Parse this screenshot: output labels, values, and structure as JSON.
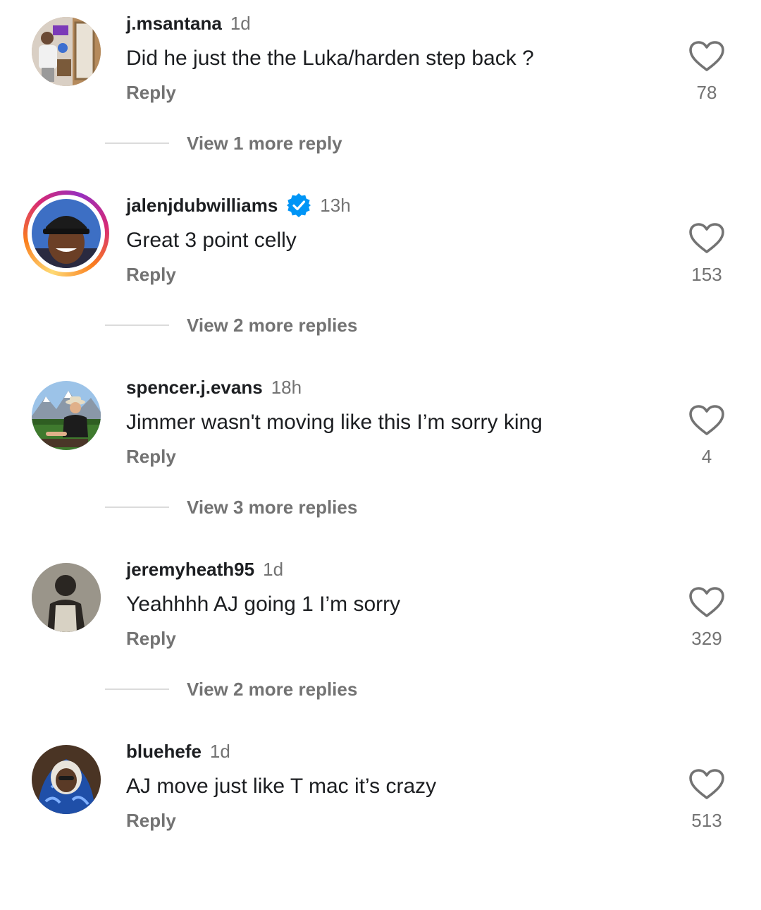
{
  "comments": [
    {
      "username": "j.msantana",
      "time": "1d",
      "text": "Did he just the the Luka/harden step back ?",
      "reply_label": "Reply",
      "likes": "78",
      "view_replies": "View 1 more reply",
      "verified": false,
      "avatar": "avatar-mirror-selfie"
    },
    {
      "username": "jalenjdubwilliams",
      "time": "13h",
      "text": "Great 3 point celly",
      "reply_label": "Reply",
      "likes": "153",
      "view_replies": "View 2 more replies",
      "verified": true,
      "avatar": "avatar-champions-cap"
    },
    {
      "username": "spencer.j.evans",
      "time": "18h",
      "text": "Jimmer wasn't moving like this I’m sorry king",
      "reply_label": "Reply",
      "likes": "4",
      "view_replies": "View 3 more replies",
      "verified": false,
      "avatar": "avatar-cowboy-mountains"
    },
    {
      "username": "jeremyheath95",
      "time": "1d",
      "text": "Yeahhhh AJ going 1 I’m sorry",
      "reply_label": "Reply",
      "likes": "329",
      "view_replies": "View 2 more replies",
      "verified": false,
      "avatar": "avatar-vintage-rockets"
    },
    {
      "username": "bluehefe",
      "time": "1d",
      "text": "AJ move just like T mac it’s crazy",
      "reply_label": "Reply",
      "likes": "513",
      "view_replies": "",
      "verified": false,
      "avatar": "avatar-blue-hoodie"
    }
  ],
  "icons": {
    "like": "heart-outline-icon",
    "verified": "verified-badge-icon"
  },
  "colors": {
    "text_primary": "#1c1e21",
    "text_secondary": "#737373",
    "verified_blue": "#0095f6",
    "divider": "#dbdbdb"
  }
}
